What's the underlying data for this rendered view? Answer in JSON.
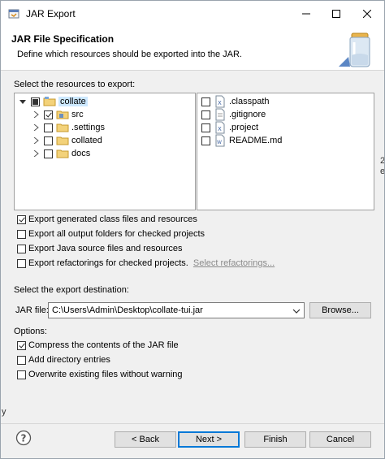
{
  "window": {
    "title": "JAR Export",
    "minimize_icon": "minimize-icon",
    "maximize_icon": "maximize-icon",
    "close_icon": "close-icon"
  },
  "banner": {
    "title": "JAR File Specification",
    "description": "Define which resources should be exported into the JAR.",
    "image_icon": "jar-icon"
  },
  "resources": {
    "label": "Select the resources to export:",
    "tree": [
      {
        "name": "collate",
        "expanded": true,
        "state": "partial",
        "icon": "project-folder-icon",
        "selected": true
      },
      {
        "name": "src",
        "expanded": false,
        "state": "checked",
        "icon": "source-folder-icon"
      },
      {
        "name": ".settings",
        "expanded": false,
        "state": "unchecked",
        "icon": "folder-icon"
      },
      {
        "name": "collated",
        "expanded": false,
        "state": "unchecked",
        "icon": "folder-icon"
      },
      {
        "name": "docs",
        "expanded": false,
        "state": "unchecked",
        "icon": "folder-icon"
      }
    ],
    "files": [
      {
        "name": ".classpath",
        "checked": false,
        "icon": "xml-file-icon"
      },
      {
        "name": ".gitignore",
        "checked": false,
        "icon": "text-file-icon"
      },
      {
        "name": ".project",
        "checked": false,
        "icon": "xml-file-icon"
      },
      {
        "name": "README.md",
        "checked": false,
        "icon": "markdown-file-icon"
      }
    ]
  },
  "export_options": [
    {
      "label": "Export generated class files and resources",
      "checked": true
    },
    {
      "label": "Export all output folders for checked projects",
      "checked": false
    },
    {
      "label": "Export Java source files and resources",
      "checked": false
    },
    {
      "label": "Export refactorings for checked projects.",
      "checked": false
    }
  ],
  "select_refactorings_link": "Select refactorings...",
  "destination": {
    "label": "Select the export destination:",
    "jar_label": "JAR file:",
    "jar_value": "C:\\Users\\Admin\\Desktop\\collate-tui.jar",
    "browse_label": "Browse..."
  },
  "options": {
    "label": "Options:",
    "items": [
      {
        "label": "Compress the contents of the JAR file",
        "checked": true
      },
      {
        "label": "Add directory entries",
        "checked": false
      },
      {
        "label": "Overwrite existing files without warning",
        "checked": false
      }
    ]
  },
  "buttons": {
    "back": "< Back",
    "next": "Next >",
    "finish": "Finish",
    "cancel": "Cancel",
    "help_icon": "help-icon"
  },
  "edge_fragments": {
    "a": "2",
    "b": "e",
    "c": "y"
  }
}
